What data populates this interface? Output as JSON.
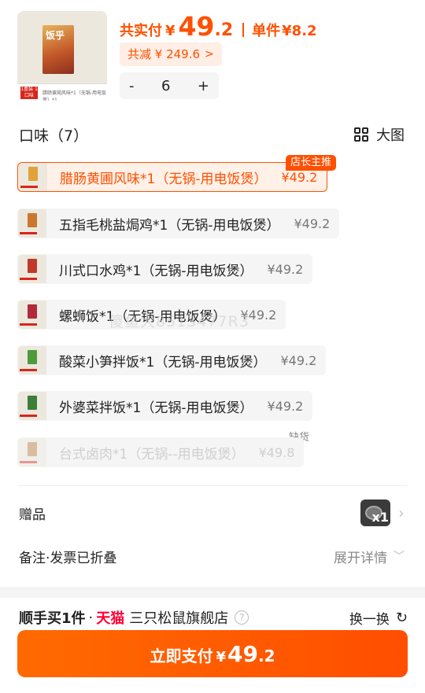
{
  "product": {
    "cover_title": "饭乎",
    "cover_tag": "1盒装 1口味",
    "cover_caption": "腊肠黄闖风味*1（无锅-用电饭煲）*1"
  },
  "price": {
    "total_label": "共实付",
    "currency": "¥",
    "total_int": "49",
    "total_dec": ".2",
    "unit_label": "单件",
    "unit_price": "¥8.2",
    "discount_text": "共减 ¥ 249.6",
    "discount_chevron": ">"
  },
  "quantity": {
    "minus": "-",
    "value": "6",
    "plus": "+"
  },
  "flavor": {
    "title": "口味（7）",
    "view_label": "大图",
    "recommend_badge": "店长主推",
    "out_of_stock_badge": "缺货",
    "options": [
      {
        "label": "腊肠黄圃风味*1（无锅-用电饭煲）",
        "price": "¥49.2",
        "state": "selected",
        "color": "#e0a23a"
      },
      {
        "label": "五指毛桃盐焗鸡*1（无锅-用电饭煲）",
        "price": "¥49.2",
        "state": "normal",
        "color": "#c9782e"
      },
      {
        "label": "川式口水鸡*1（无锅-用电饭煲）",
        "price": "¥49.2",
        "state": "normal",
        "color": "#c0392b"
      },
      {
        "label": "螺蛳饭*1（无锅-用电饭煲）",
        "price": "¥49.2",
        "state": "normal",
        "color": "#b02a3a"
      },
      {
        "label": "酸菜小笋拌饭*1（无锅-用电饭煲）",
        "price": "¥49.2",
        "state": "normal",
        "color": "#4e9a3c"
      },
      {
        "label": "外婆菜拌饭*1（无锅-用电饭煲）",
        "price": "¥49.2",
        "state": "normal",
        "color": "#3d7d39"
      },
      {
        "label": "台式卤肉*1（无锅--用电饭煲）",
        "price": "¥49.8",
        "state": "disabled",
        "color": "#b57a3a"
      }
    ]
  },
  "watermark": "傻鱼大8513477R3",
  "gift": {
    "label": "赠品",
    "badge": "x1"
  },
  "note": {
    "label": "备注·发票已折叠",
    "expand": "展开详情"
  },
  "addon": {
    "buy_label": "顺手买1件",
    "dot": "·",
    "platform": "天猫",
    "shop_name": "三只松鼠旗舰店",
    "help": "?",
    "swap_label": "换一换"
  },
  "pay": {
    "label": "立即支付",
    "currency": "¥",
    "amount_int": "49",
    "amount_dec": ".2"
  },
  "colors": {
    "accent": "#ff5000",
    "selected_bg": "#fff1e8",
    "option_bg": "#f5f5f5",
    "tmall_red": "#ff0036"
  }
}
